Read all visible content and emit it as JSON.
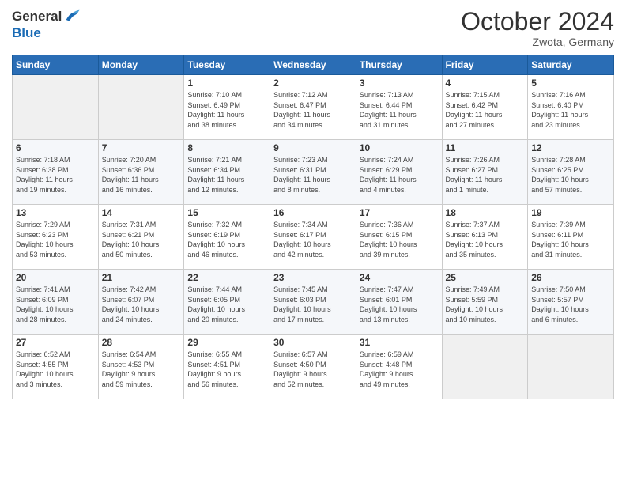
{
  "header": {
    "logo_general": "General",
    "logo_blue": "Blue",
    "month": "October 2024",
    "location": "Zwota, Germany"
  },
  "weekdays": [
    "Sunday",
    "Monday",
    "Tuesday",
    "Wednesday",
    "Thursday",
    "Friday",
    "Saturday"
  ],
  "weeks": [
    [
      {
        "day": "",
        "info": ""
      },
      {
        "day": "",
        "info": ""
      },
      {
        "day": "1",
        "info": "Sunrise: 7:10 AM\nSunset: 6:49 PM\nDaylight: 11 hours\nand 38 minutes."
      },
      {
        "day": "2",
        "info": "Sunrise: 7:12 AM\nSunset: 6:47 PM\nDaylight: 11 hours\nand 34 minutes."
      },
      {
        "day": "3",
        "info": "Sunrise: 7:13 AM\nSunset: 6:44 PM\nDaylight: 11 hours\nand 31 minutes."
      },
      {
        "day": "4",
        "info": "Sunrise: 7:15 AM\nSunset: 6:42 PM\nDaylight: 11 hours\nand 27 minutes."
      },
      {
        "day": "5",
        "info": "Sunrise: 7:16 AM\nSunset: 6:40 PM\nDaylight: 11 hours\nand 23 minutes."
      }
    ],
    [
      {
        "day": "6",
        "info": "Sunrise: 7:18 AM\nSunset: 6:38 PM\nDaylight: 11 hours\nand 19 minutes."
      },
      {
        "day": "7",
        "info": "Sunrise: 7:20 AM\nSunset: 6:36 PM\nDaylight: 11 hours\nand 16 minutes."
      },
      {
        "day": "8",
        "info": "Sunrise: 7:21 AM\nSunset: 6:34 PM\nDaylight: 11 hours\nand 12 minutes."
      },
      {
        "day": "9",
        "info": "Sunrise: 7:23 AM\nSunset: 6:31 PM\nDaylight: 11 hours\nand 8 minutes."
      },
      {
        "day": "10",
        "info": "Sunrise: 7:24 AM\nSunset: 6:29 PM\nDaylight: 11 hours\nand 4 minutes."
      },
      {
        "day": "11",
        "info": "Sunrise: 7:26 AM\nSunset: 6:27 PM\nDaylight: 11 hours\nand 1 minute."
      },
      {
        "day": "12",
        "info": "Sunrise: 7:28 AM\nSunset: 6:25 PM\nDaylight: 10 hours\nand 57 minutes."
      }
    ],
    [
      {
        "day": "13",
        "info": "Sunrise: 7:29 AM\nSunset: 6:23 PM\nDaylight: 10 hours\nand 53 minutes."
      },
      {
        "day": "14",
        "info": "Sunrise: 7:31 AM\nSunset: 6:21 PM\nDaylight: 10 hours\nand 50 minutes."
      },
      {
        "day": "15",
        "info": "Sunrise: 7:32 AM\nSunset: 6:19 PM\nDaylight: 10 hours\nand 46 minutes."
      },
      {
        "day": "16",
        "info": "Sunrise: 7:34 AM\nSunset: 6:17 PM\nDaylight: 10 hours\nand 42 minutes."
      },
      {
        "day": "17",
        "info": "Sunrise: 7:36 AM\nSunset: 6:15 PM\nDaylight: 10 hours\nand 39 minutes."
      },
      {
        "day": "18",
        "info": "Sunrise: 7:37 AM\nSunset: 6:13 PM\nDaylight: 10 hours\nand 35 minutes."
      },
      {
        "day": "19",
        "info": "Sunrise: 7:39 AM\nSunset: 6:11 PM\nDaylight: 10 hours\nand 31 minutes."
      }
    ],
    [
      {
        "day": "20",
        "info": "Sunrise: 7:41 AM\nSunset: 6:09 PM\nDaylight: 10 hours\nand 28 minutes."
      },
      {
        "day": "21",
        "info": "Sunrise: 7:42 AM\nSunset: 6:07 PM\nDaylight: 10 hours\nand 24 minutes."
      },
      {
        "day": "22",
        "info": "Sunrise: 7:44 AM\nSunset: 6:05 PM\nDaylight: 10 hours\nand 20 minutes."
      },
      {
        "day": "23",
        "info": "Sunrise: 7:45 AM\nSunset: 6:03 PM\nDaylight: 10 hours\nand 17 minutes."
      },
      {
        "day": "24",
        "info": "Sunrise: 7:47 AM\nSunset: 6:01 PM\nDaylight: 10 hours\nand 13 minutes."
      },
      {
        "day": "25",
        "info": "Sunrise: 7:49 AM\nSunset: 5:59 PM\nDaylight: 10 hours\nand 10 minutes."
      },
      {
        "day": "26",
        "info": "Sunrise: 7:50 AM\nSunset: 5:57 PM\nDaylight: 10 hours\nand 6 minutes."
      }
    ],
    [
      {
        "day": "27",
        "info": "Sunrise: 6:52 AM\nSunset: 4:55 PM\nDaylight: 10 hours\nand 3 minutes."
      },
      {
        "day": "28",
        "info": "Sunrise: 6:54 AM\nSunset: 4:53 PM\nDaylight: 9 hours\nand 59 minutes."
      },
      {
        "day": "29",
        "info": "Sunrise: 6:55 AM\nSunset: 4:51 PM\nDaylight: 9 hours\nand 56 minutes."
      },
      {
        "day": "30",
        "info": "Sunrise: 6:57 AM\nSunset: 4:50 PM\nDaylight: 9 hours\nand 52 minutes."
      },
      {
        "day": "31",
        "info": "Sunrise: 6:59 AM\nSunset: 4:48 PM\nDaylight: 9 hours\nand 49 minutes."
      },
      {
        "day": "",
        "info": ""
      },
      {
        "day": "",
        "info": ""
      }
    ]
  ]
}
